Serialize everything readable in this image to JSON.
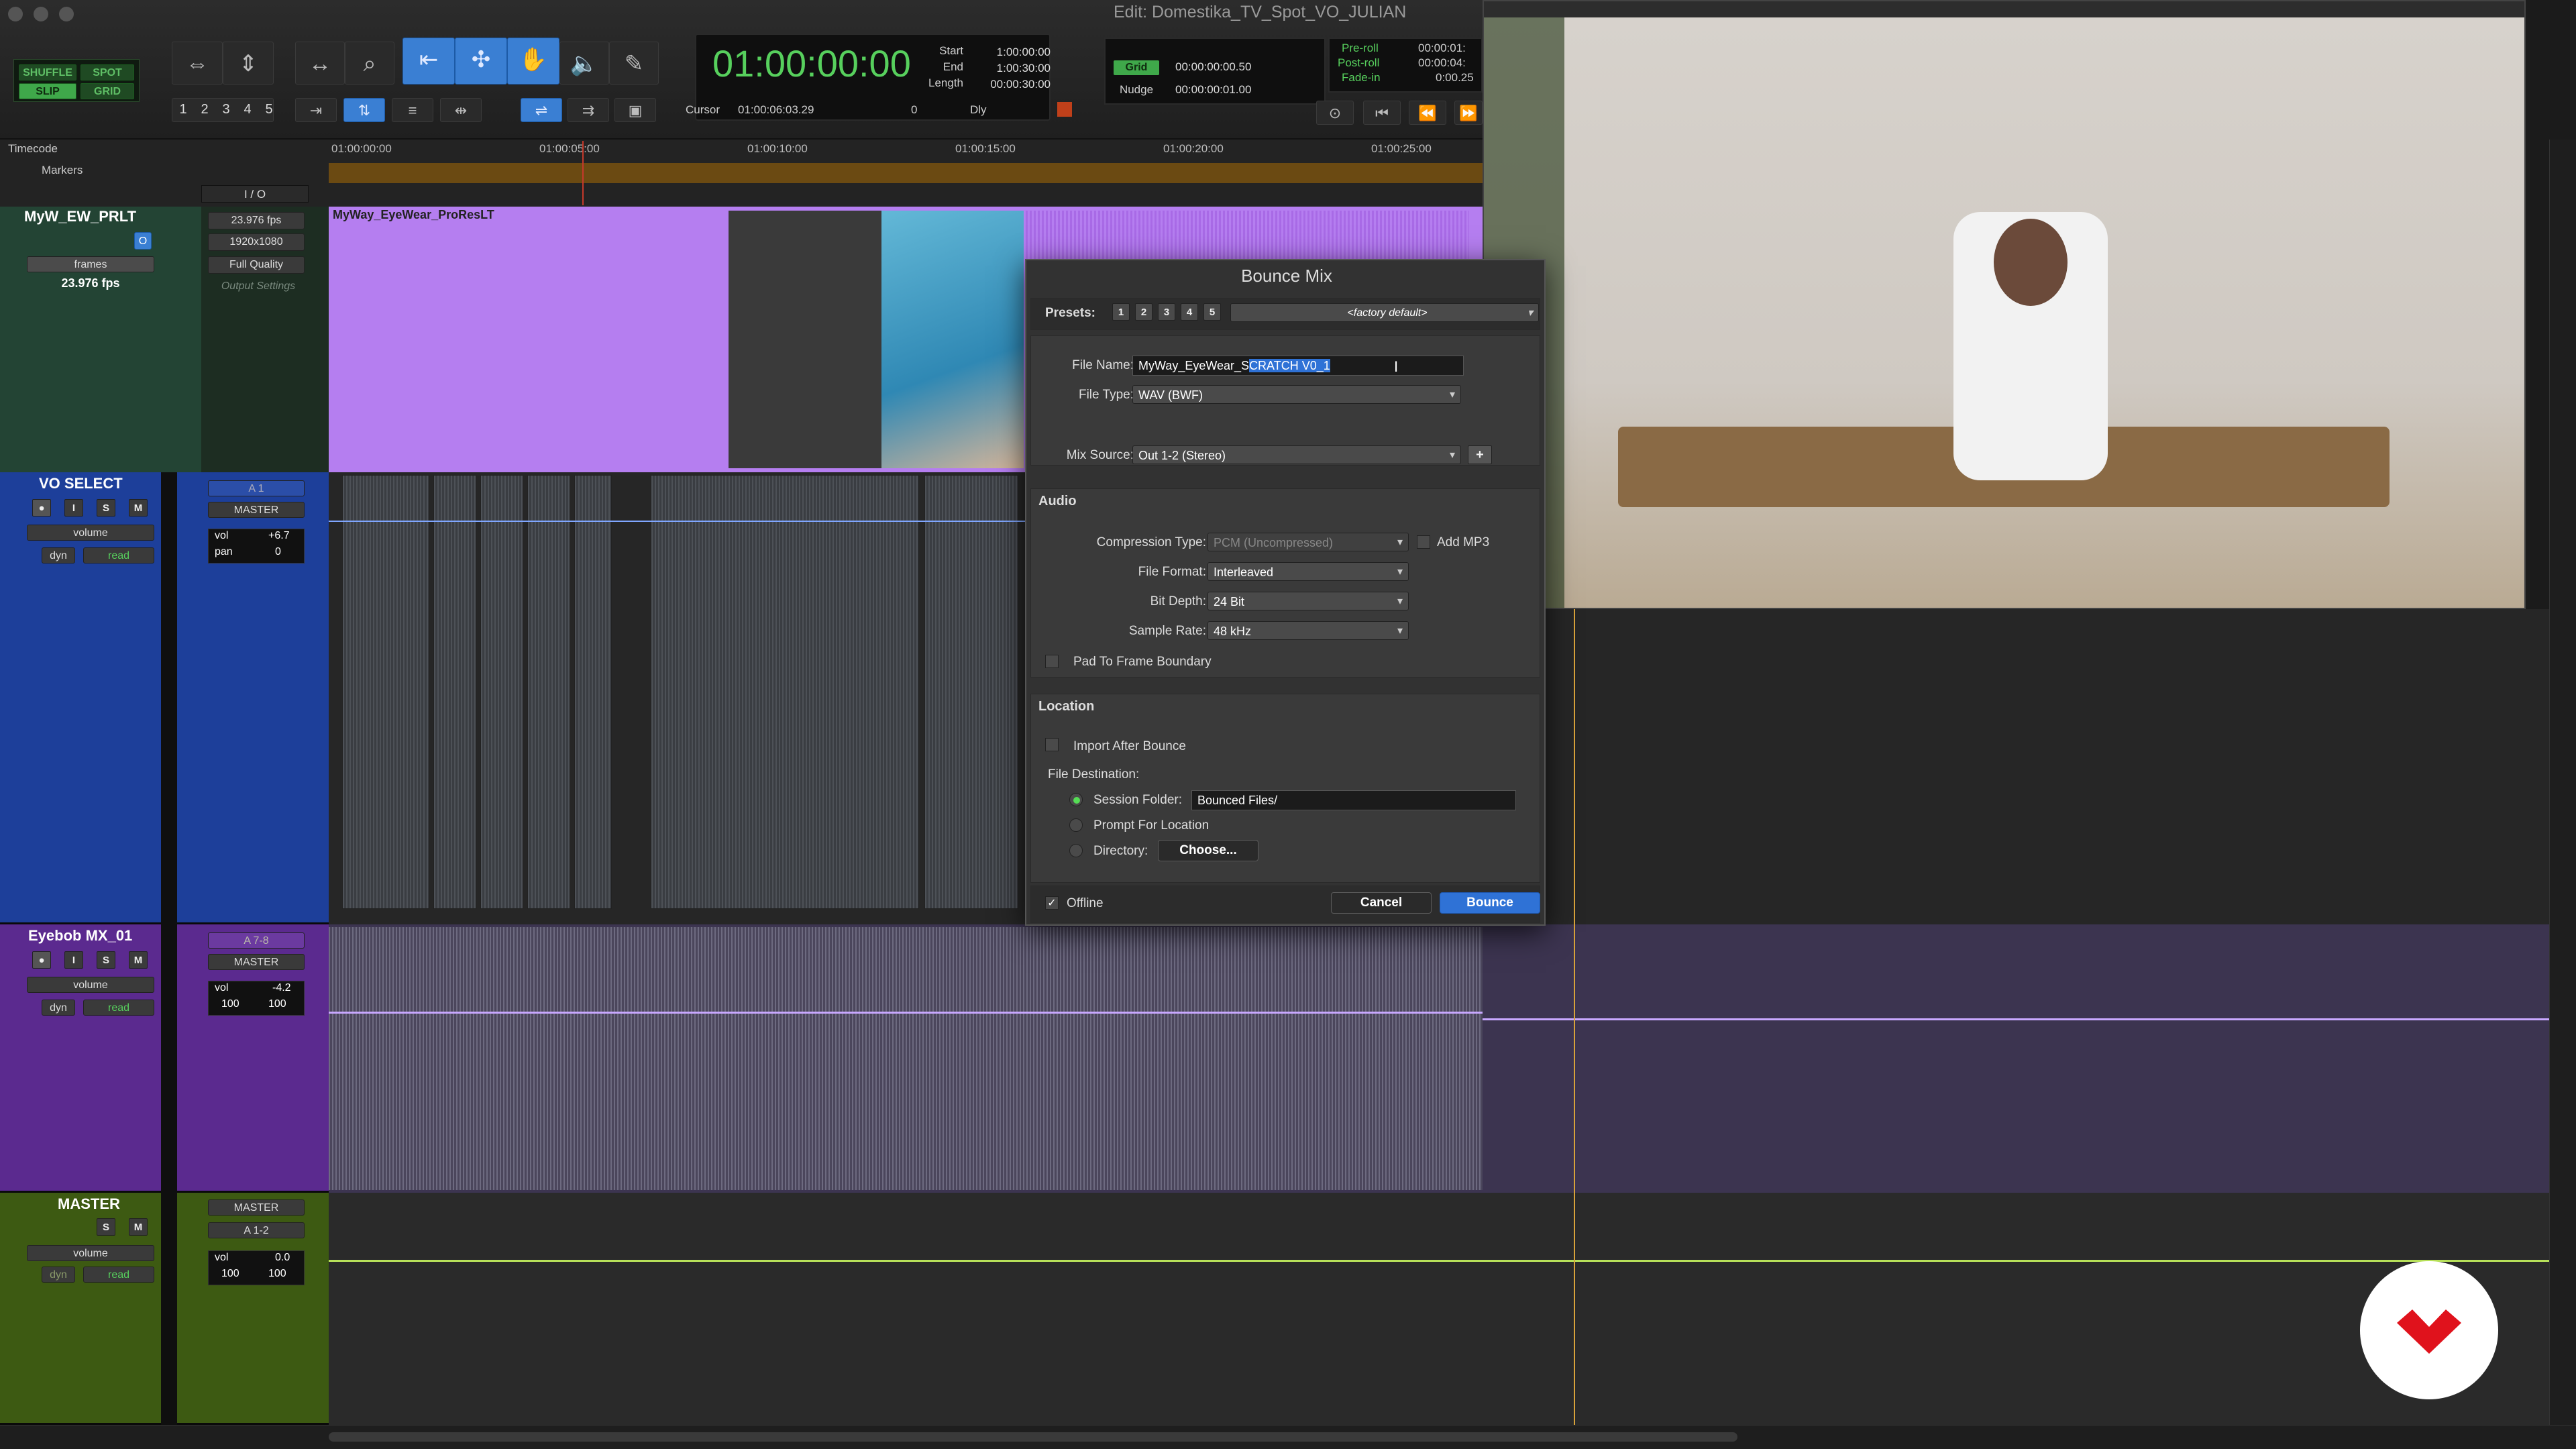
{
  "window": {
    "title": "Edit: Domestika_TV_Spot_VO_JULIAN"
  },
  "modes": {
    "shuffle": "SHUFFLE",
    "spot": "SPOT",
    "slip": "SLIP",
    "grid": "GRID"
  },
  "zoom_presets": [
    "1",
    "2",
    "3",
    "4",
    "5"
  ],
  "counter": {
    "main": "01:00:00:00",
    "start_label": "Start",
    "start": "1:00:00:00",
    "end_label": "End",
    "end": "1:00:30:00",
    "length_label": "Length",
    "length": "00:00:30:00",
    "cursor_label": "Cursor",
    "cursor": "01:00:06:03.29",
    "cursor_val": "0",
    "dly": "Dly"
  },
  "grid": {
    "label": "Grid",
    "value": "00:00:00:00.50",
    "nudge_label": "Nudge",
    "nudge_value": "00:00:00:01.00"
  },
  "preroll": {
    "pre_label": "Pre-roll",
    "post_label": "Post-roll",
    "fade_label": "Fade-in",
    "pre": "00:00:01:",
    "post": "00:00:04:",
    "fade": "0:00.25"
  },
  "rulers": {
    "timecode_label": "Timecode",
    "markers_label": "Markers",
    "io_label": "I / O",
    "ticks": [
      "01:00:00:00",
      "01:00:05:00",
      "01:00:10:00",
      "01:00:15:00",
      "01:00:20:00",
      "01:00:25:00"
    ]
  },
  "tracks": {
    "video": {
      "name": "MyW_EW_PRLT",
      "fps": "23.976 fps",
      "res": "1920x1080",
      "quality": "Full Quality",
      "output": "Output Settings",
      "frames": "frames",
      "fps_label": "23.976 fps",
      "clip": "MyWay_EyeWear_ProResLT"
    },
    "vo": {
      "name": "VO SELECT",
      "input": "A 1",
      "output": "MASTER",
      "view": "volume",
      "dyn": "dyn",
      "read": "read",
      "vol_label": "vol",
      "vol": "+6.7",
      "pan_label": "pan",
      "pan": "0"
    },
    "mx": {
      "name": "Eyebob MX_01",
      "input": "A 7-8",
      "output": "MASTER",
      "view": "volume",
      "dyn": "dyn",
      "read": "read",
      "vol_label": "vol",
      "vol": "-4.2",
      "pan_l": "100",
      "pan_r": "100"
    },
    "master": {
      "name": "MASTER",
      "output": "MASTER",
      "bus": "A 1-2",
      "view": "volume",
      "dyn": "dyn",
      "read": "read",
      "vol_label": "vol",
      "vol": "0.0",
      "pan_l": "100",
      "pan_r": "100"
    }
  },
  "dialog": {
    "title": "Bounce Mix",
    "presets_label": "Presets:",
    "presets": [
      "1",
      "2",
      "3",
      "4",
      "5"
    ],
    "preset_value": "<factory default>",
    "file_name_label": "File Name:",
    "file_name_prefix": "MyWay_EyeWear_S",
    "file_name_selected": "CRATCH V0_1",
    "file_type_label": "File Type:",
    "file_type": "WAV (BWF)",
    "mix_source_label": "Mix Source:",
    "mix_source": "Out 1-2 (Stereo)",
    "audio_title": "Audio",
    "compression_label": "Compression Type:",
    "compression": "PCM (Uncompressed)",
    "add_mp3": "Add MP3",
    "format_label": "File Format:",
    "format": "Interleaved",
    "bitdepth_label": "Bit Depth:",
    "bitdepth": "24 Bit",
    "samplerate_label": "Sample Rate:",
    "samplerate": "48 kHz",
    "pad": "Pad To Frame Boundary",
    "location_title": "Location",
    "import_after": "Import After Bounce",
    "destination_label": "File Destination:",
    "session_folder_label": "Session Folder:",
    "session_folder": "Bounced Files/",
    "prompt_location": "Prompt For Location",
    "directory_label": "Directory:",
    "choose": "Choose...",
    "offline": "Offline",
    "cancel": "Cancel",
    "bounce": "Bounce"
  },
  "colors": {
    "video_clip": "#b57ef0",
    "vo_track": "#1d3f9a",
    "mx_track": "#5b2a8f",
    "master_track": "#3d5a12",
    "accent_blue": "#2f72d6",
    "green": "#57d05d"
  }
}
